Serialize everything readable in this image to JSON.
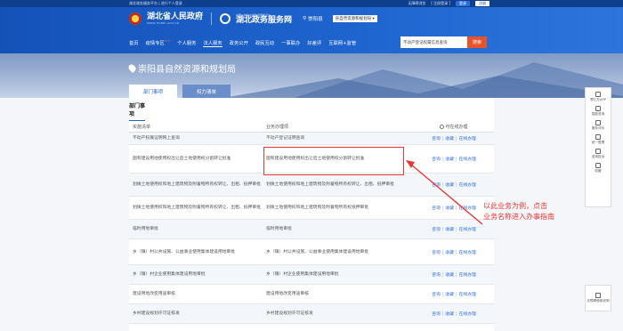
{
  "topbar": {
    "left_text": "湖北政务服务平台 | 进行个人登录",
    "right_links": [
      "无障碍浏览",
      "[ 注册登录 ]"
    ],
    "login_label": "登录",
    "register_label": "注册"
  },
  "header": {
    "gov_name": "湖北省人民政府",
    "gov_sub": "WWW.HUBEI.GOV.CN",
    "svc_sub": "全国一体化在线政务服务平台",
    "svc_name": "湖北政务服务网",
    "location": "崇阳县",
    "dept_select": "县自然资源和规划局 ▾"
  },
  "nav": {
    "items": [
      "首页",
      "疫情专区",
      "个人服务",
      "法人服务",
      "政务公开",
      "政民互动",
      "一事联办",
      "好差评",
      "互联网+监管"
    ],
    "hot": "HOT"
  },
  "search": {
    "value": "不动产登记权属信息查询",
    "button": "搜索"
  },
  "banner": {
    "title": "崇阳县自然资源和规划局",
    "tabs": [
      "部门事项",
      "权力清单"
    ]
  },
  "section": {
    "title": "部门事项",
    "col1": "实施清单",
    "col2": "业务办理项",
    "col3": "可在线办理"
  },
  "rows": [
    {
      "c1": "不动产权属证明网上查询",
      "c2": "不动产登记证明查询",
      "ops": [
        "咨询",
        "收藏",
        "在线办理"
      ]
    },
    {
      "c1": "国有建设用地使用权出让后土地使用权分割转让批准",
      "c2": "国有建设用地使用权出让后土地使用权分割转让批准",
      "ops": [
        "咨询",
        "收藏",
        "在线办理"
      ]
    },
    {
      "c1": "划拨土地使用权和地上建筑物及附着物所有权转让、出租、抵押审批",
      "c2": "划拨土地使用权和地上建筑物及附着物所有权转让、出租、抵押审批",
      "ops": [
        "咨询",
        "收藏",
        "在线办理"
      ]
    },
    {
      "c1": "划拨土地使用权和地上建筑物及附着物所有权转让、出租、抵押审批",
      "c2": "划拨土地使用权和地上建筑物及附着物所有权抵押审批",
      "ops": [
        "咨询",
        "收藏",
        "在线办理"
      ]
    },
    {
      "c1": "临时用地审批",
      "c2": "临时用地审批",
      "ops": [
        "咨询",
        "收藏",
        "在线办理"
      ]
    },
    {
      "c1": "乡（镇）村公共设施、公益事业使用集体建设用地审批",
      "c2": "乡（镇）村公共设施、公益事业使用集体建设用地审批",
      "ops": [
        "咨询",
        "收藏",
        "在线办理"
      ]
    },
    {
      "c1": "乡（镇）村企业使用集体建设用地审批",
      "c2": "乡（镇）村企业使用集体建设用地审批",
      "ops": [
        "咨询",
        "收藏",
        "在线办理"
      ]
    },
    {
      "c1": "建设用地改变用途审核",
      "c2": "建设用地改变用途审核",
      "ops": [
        "咨询",
        "收藏",
        "在线办理"
      ]
    },
    {
      "c1": "乡村建设规划许可证核发",
      "c2": "乡村建设规划许可证核发",
      "ops": [
        "咨询",
        "收藏",
        "在线办理"
      ]
    }
  ],
  "annotation": {
    "line1": "以此业务为例，点击",
    "line2": "业务名称进入办事指南"
  },
  "sidebar": {
    "items": [
      "鄂汇办APP",
      "智能咨询",
      "服务评价",
      "统一受理",
      "咨询投诉",
      "收藏"
    ],
    "bottom": "无障碍使用说明"
  }
}
